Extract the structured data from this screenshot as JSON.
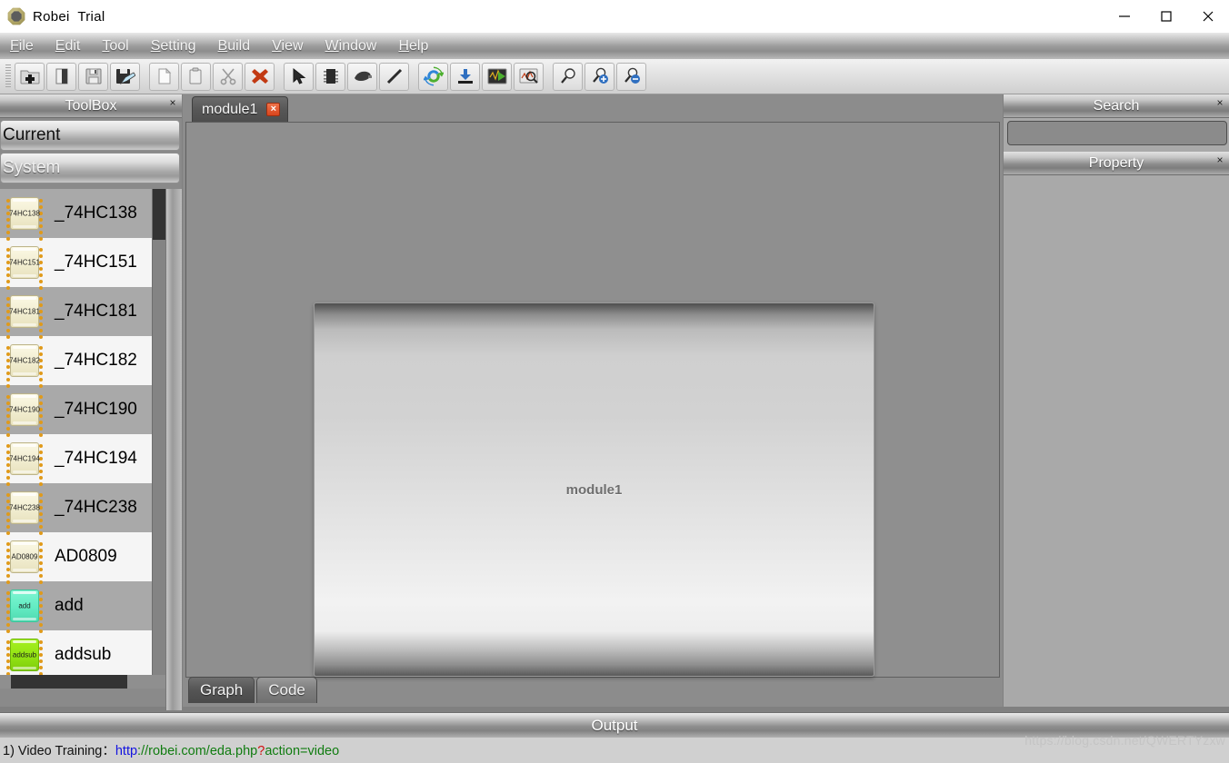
{
  "window": {
    "title": "Robei  Trial",
    "logo_icon": "robei-hex-logo",
    "controls": {
      "minimize": "minimize-icon",
      "maximize": "maximize-icon",
      "close": "close-icon"
    }
  },
  "menubar": [
    {
      "label": "File",
      "mnemonic": "F"
    },
    {
      "label": "Edit",
      "mnemonic": "E"
    },
    {
      "label": "Tool",
      "mnemonic": "T"
    },
    {
      "label": "Setting",
      "mnemonic": "S"
    },
    {
      "label": "Build",
      "mnemonic": "B"
    },
    {
      "label": "View",
      "mnemonic": "V"
    },
    {
      "label": "Window",
      "mnemonic": "W"
    },
    {
      "label": "Help",
      "mnemonic": "H"
    }
  ],
  "toolbar": {
    "groups": [
      [
        "new-project-icon",
        "open-folder-icon",
        "save-icon",
        "save-as-icon"
      ],
      [
        "new-file-icon",
        "paste-icon",
        "cut-scissors-icon",
        "delete-x-icon"
      ],
      [
        "select-arrow-icon",
        "chip-module-icon",
        "port-connector-icon",
        "wire-line-icon"
      ],
      [
        "compile-refresh-icon",
        "download-icon",
        "simulate-run-icon",
        "waveform-search-icon"
      ],
      [
        "zoom-normal-icon",
        "zoom-in-icon",
        "zoom-out-icon"
      ]
    ]
  },
  "toolbox": {
    "title": "ToolBox",
    "close_icon": "close-icon",
    "sections": [
      {
        "label": "Current",
        "style": "dark-text"
      },
      {
        "label": "System",
        "style": "light-text"
      }
    ],
    "items": [
      {
        "label": "_74HC138",
        "chip_text": "74HC138",
        "color": "ivory",
        "selected": true
      },
      {
        "label": "_74HC151",
        "chip_text": "74HC151",
        "color": "ivory",
        "selected": false
      },
      {
        "label": "_74HC181",
        "chip_text": "74HC181",
        "color": "ivory",
        "selected": true
      },
      {
        "label": "_74HC182",
        "chip_text": "74HC182",
        "color": "ivory",
        "selected": false
      },
      {
        "label": "_74HC190",
        "chip_text": "74HC190",
        "color": "ivory",
        "selected": true
      },
      {
        "label": "_74HC194",
        "chip_text": "74HC194",
        "color": "ivory",
        "selected": false
      },
      {
        "label": "_74HC238",
        "chip_text": "74HC238",
        "color": "ivory",
        "selected": true
      },
      {
        "label": "AD0809",
        "chip_text": "AD0809",
        "color": "ivory",
        "selected": false
      },
      {
        "label": "add",
        "chip_text": "add",
        "color": "mint",
        "selected": true
      },
      {
        "label": "addsub",
        "chip_text": "addsub",
        "color": "green",
        "selected": false
      }
    ]
  },
  "editor": {
    "document_tab": {
      "label": "module1",
      "close_icon": "close-icon"
    },
    "canvas": {
      "module_label": "module1"
    },
    "view_tabs": [
      {
        "label": "Graph",
        "active": true
      },
      {
        "label": "Code",
        "active": false
      }
    ]
  },
  "right_panels": {
    "search": {
      "title": "Search",
      "close_icon": "close-icon",
      "input_value": "",
      "input_placeholder": ""
    },
    "property": {
      "title": "Property",
      "close_icon": "close-icon"
    }
  },
  "output": {
    "title": "Output",
    "lines": [
      {
        "prefix": "1) Video Training：",
        "url_parts": [
          {
            "text": "http",
            "color": "blue"
          },
          {
            "text": "://robei.com/eda.php",
            "color": "green"
          },
          {
            "text": "?",
            "color": "red"
          },
          {
            "text": "action=video",
            "color": "green"
          }
        ]
      }
    ]
  },
  "watermark": {
    "text": "https://blog.csdn.net/QWERTYzxw"
  },
  "colors": {
    "accent_red": "#d8441c",
    "chip_ivory": "#f2eed2",
    "chip_mint": "#63ecc3",
    "chip_green": "#93e413",
    "panel_gray": "#8a8a8a"
  }
}
